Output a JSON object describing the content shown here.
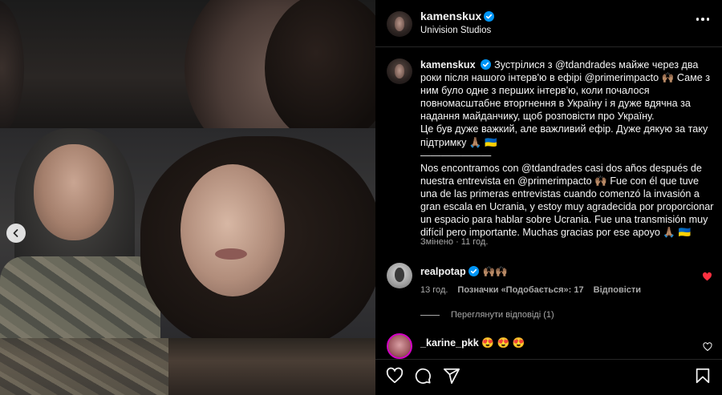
{
  "post": {
    "author": "kamenskux",
    "subtitle": "Univision Studios"
  },
  "caption": {
    "username": "kamenskux",
    "text_ua": "Зустрілися з @tdandrades майже через два роки після нашого інтерв'ю в ефірі @primerimpacto 🙌🏽 Саме з ним було одне з перших інтерв'ю, коли почалося повномасштабне вторгнення в Україну і я дуже вдячна за надання майданчику, щоб розповісти про Україну.",
    "text_ua2": "Це був дуже важкий, але важливий ефір. Дуже дякую за таку підтримку 🙏🏽 🇺🇦",
    "separator": "———————",
    "text_es": "Nos encontramos con @tdandrades casi dos años después de nuestra entrevista en @primerimpacto 🙌🏽 Fue con él que tuve una de las primeras entrevistas cuando comenzó la invasión a gran escala en Ucrania, y estoy muy agradecida por proporcionar un espacio para hablar sobre Ucrania. Fue una transmisión muy difícil pero importante. Muchas gracias por ese apoyo 🙏🏽 🇺🇦",
    "meta": "Змінено · 11 год."
  },
  "comments": [
    {
      "username": "realpotap",
      "text": "🙌🏽🙌🏽",
      "time": "13 год.",
      "likes": "Позначки «Подобається»: 17",
      "reply_label": "Відповісти",
      "liked": true
    },
    {
      "username": "_karine_pkk",
      "text": "😍 😍 😍",
      "liked": false
    }
  ],
  "view_replies": "Переглянути відповіді (1)",
  "icons": {
    "verified": "verified-badge-icon",
    "more": "more-options-icon",
    "like": "heart-icon",
    "comment": "comment-icon",
    "share": "share-icon",
    "save": "bookmark-icon",
    "prev": "chevron-left-icon"
  },
  "colors": {
    "background": "#000000",
    "text": "#f5f5f5",
    "muted": "#a8a8a8",
    "verified": "#0095f6",
    "liked": "#ff3040"
  }
}
